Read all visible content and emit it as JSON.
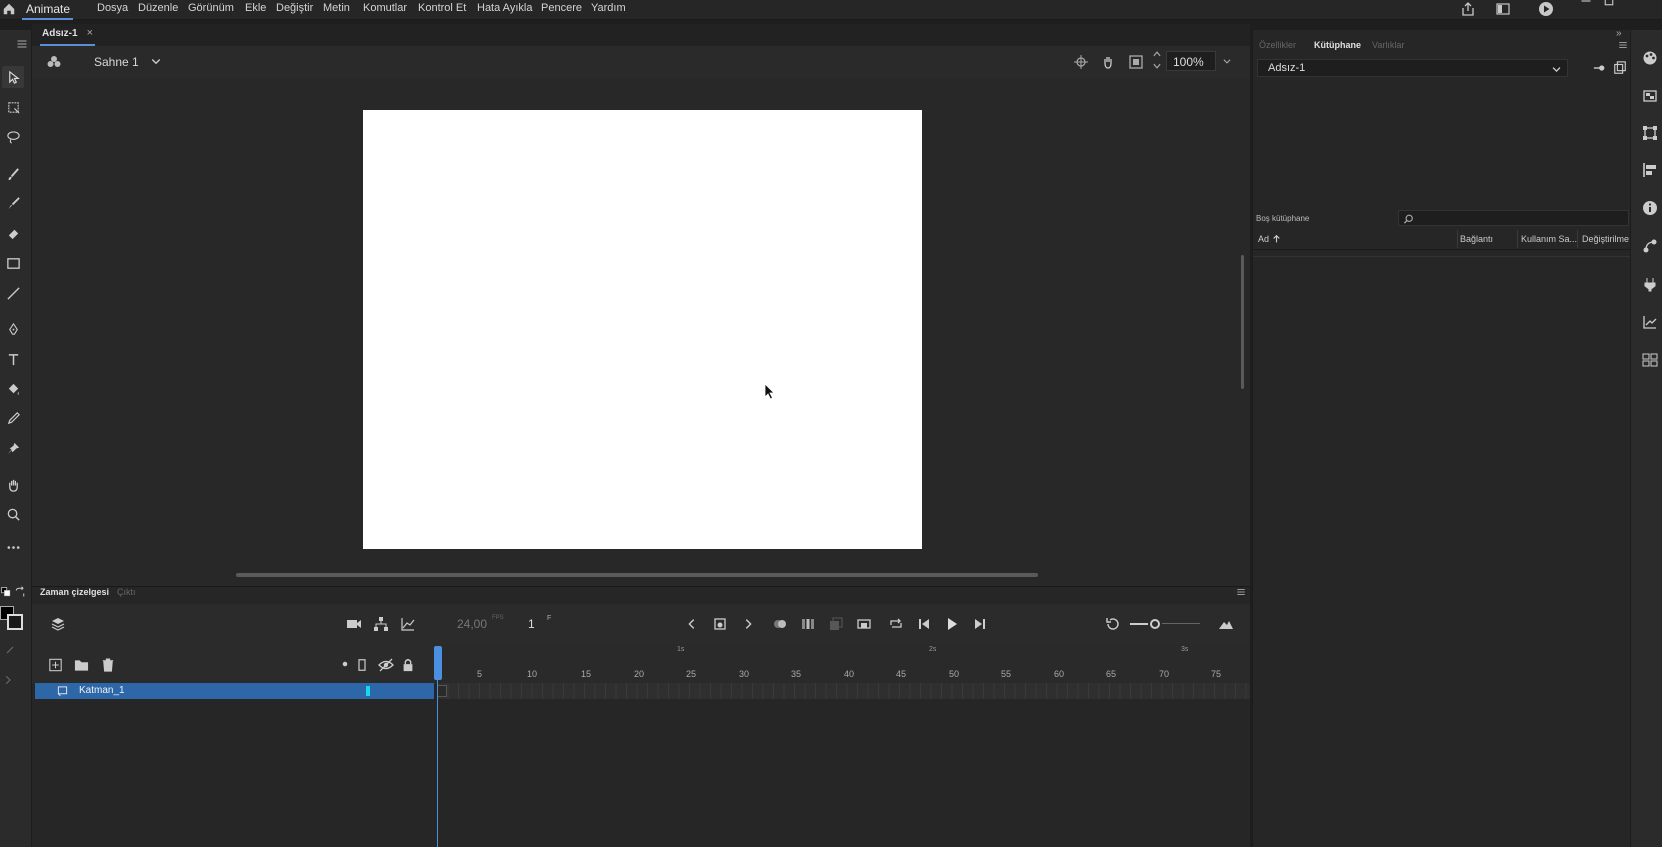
{
  "app": {
    "name": "Animate"
  },
  "menu": [
    "Dosya",
    "Düzenle",
    "Görünüm",
    "Ekle",
    "Değiştir",
    "Metin",
    "Komutlar",
    "Kontrol Et",
    "Hata Ayıkla",
    "Pencere",
    "Yardım"
  ],
  "document": {
    "tab_label": "Adsız-1",
    "close_glyph": "×"
  },
  "stage": {
    "scene_label": "Sahne 1",
    "zoom": "100%"
  },
  "timeline": {
    "tabs": [
      "Zaman çizelgesi",
      "Çıktı"
    ],
    "fps": "24,00",
    "fps_unit": "FPS",
    "frame": "1",
    "frame_unit": "F",
    "layer_name": "Katman_1",
    "ruler_numbers": [
      "5",
      "10",
      "15",
      "20",
      "25",
      "30",
      "35",
      "40",
      "45",
      "50",
      "55",
      "60",
      "65",
      "70",
      "75"
    ],
    "seconds": [
      "1s",
      "2s",
      "3s"
    ]
  },
  "right_panel": {
    "tabs": [
      "Özellikler",
      "Kütüphane",
      "Varlıklar"
    ],
    "library_select": "Adsız-1",
    "empty_library": "Boş kütüphane",
    "columns": [
      "Ad",
      "Bağlantı",
      "Kullanım Sa...",
      "Değiştirilme"
    ]
  },
  "colors": {
    "accent": "#4a8fe0",
    "layer_selected": "#2e67a8",
    "layer_color": "#16d9f0",
    "stage": "#ffffff"
  }
}
